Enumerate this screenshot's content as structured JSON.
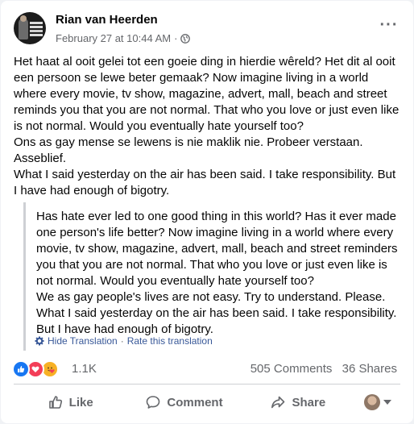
{
  "post": {
    "author": "Rian van Heerden",
    "date": "February 27 at 10:44 AM",
    "separator": "·",
    "privacy_icon": "globe-icon",
    "more_icon": "ellipsis-icon",
    "body_lines": [
      "Het haat al ooit gelei tot een goeie ding in hierdie wêreld? Het dit al ooit een persoon se lewe beter gemaak? Now imagine living in a world where every movie, tv show, magazine, advert, mall, beach and street reminds you that you are not normal. That who you love or just even like is not normal. Would you eventually hate yourself too?",
      "Ons as gay mense se lewens is nie maklik nie. Probeer verstaan. Asseblief.",
      "What I said yesterday on the air has been said. I take responsibility. But I have had enough of bigotry."
    ],
    "translation_lines": [
      "Has hate ever led to one good thing in this world? Has it ever made one person's life better? Now imagine living in a world where every movie, tv show, magazine, advert, mall, beach and street reminders you that you are not normal. That who you love or just even like is not normal. Would you eventually hate yourself too?",
      "We as gay people's lives are not easy. Try to understand. Please.",
      "What I said yesterday on the air has been said. I take responsibility. But I have had enough of bigotry."
    ],
    "hide_translation": "Hide Translation",
    "rate_translation": "Rate this translation",
    "link_separator": "·"
  },
  "stats": {
    "reactions_count": "1.1K",
    "reaction_icons": [
      "like-icon",
      "love-icon",
      "care-icon"
    ],
    "comments": "505 Comments",
    "shares": "36 Shares"
  },
  "actions": {
    "like_label": "Like",
    "comment_label": "Comment",
    "share_label": "Share"
  },
  "colors": {
    "link": "#385898",
    "secondary_text": "#65676b",
    "like_blue": "#1877f2",
    "love_red": "#f33e58",
    "care_yellow": "#f7b125"
  }
}
